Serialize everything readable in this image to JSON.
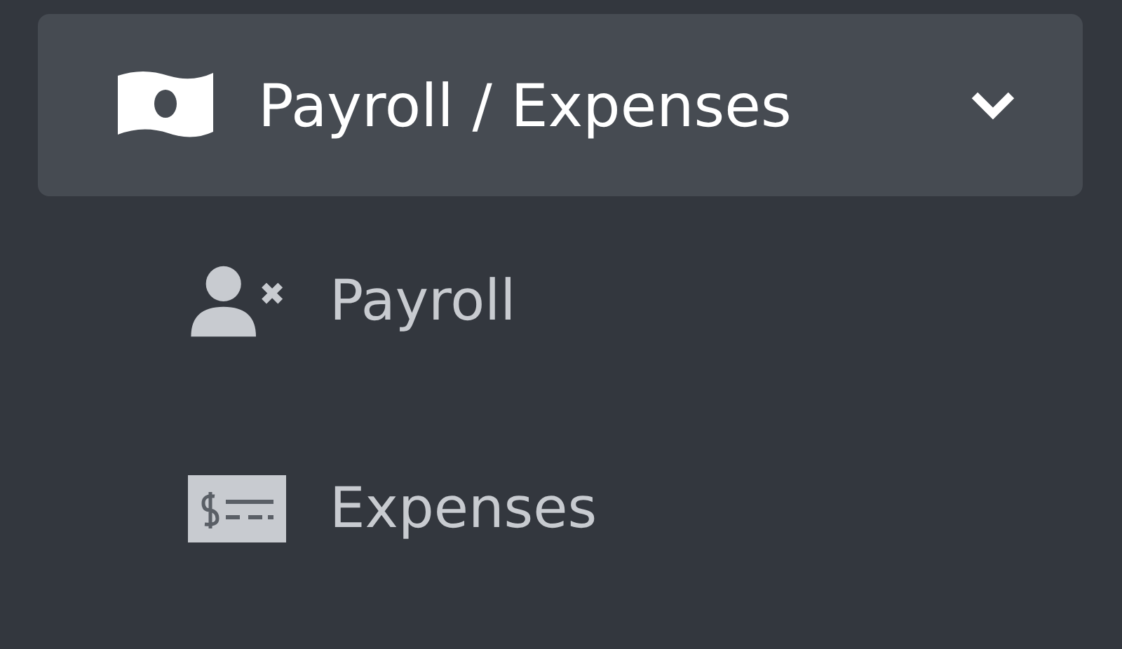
{
  "menu": {
    "label": "Payroll / Expenses",
    "expanded": true,
    "children": [
      {
        "label": "Payroll"
      },
      {
        "label": "Expenses"
      }
    ]
  }
}
